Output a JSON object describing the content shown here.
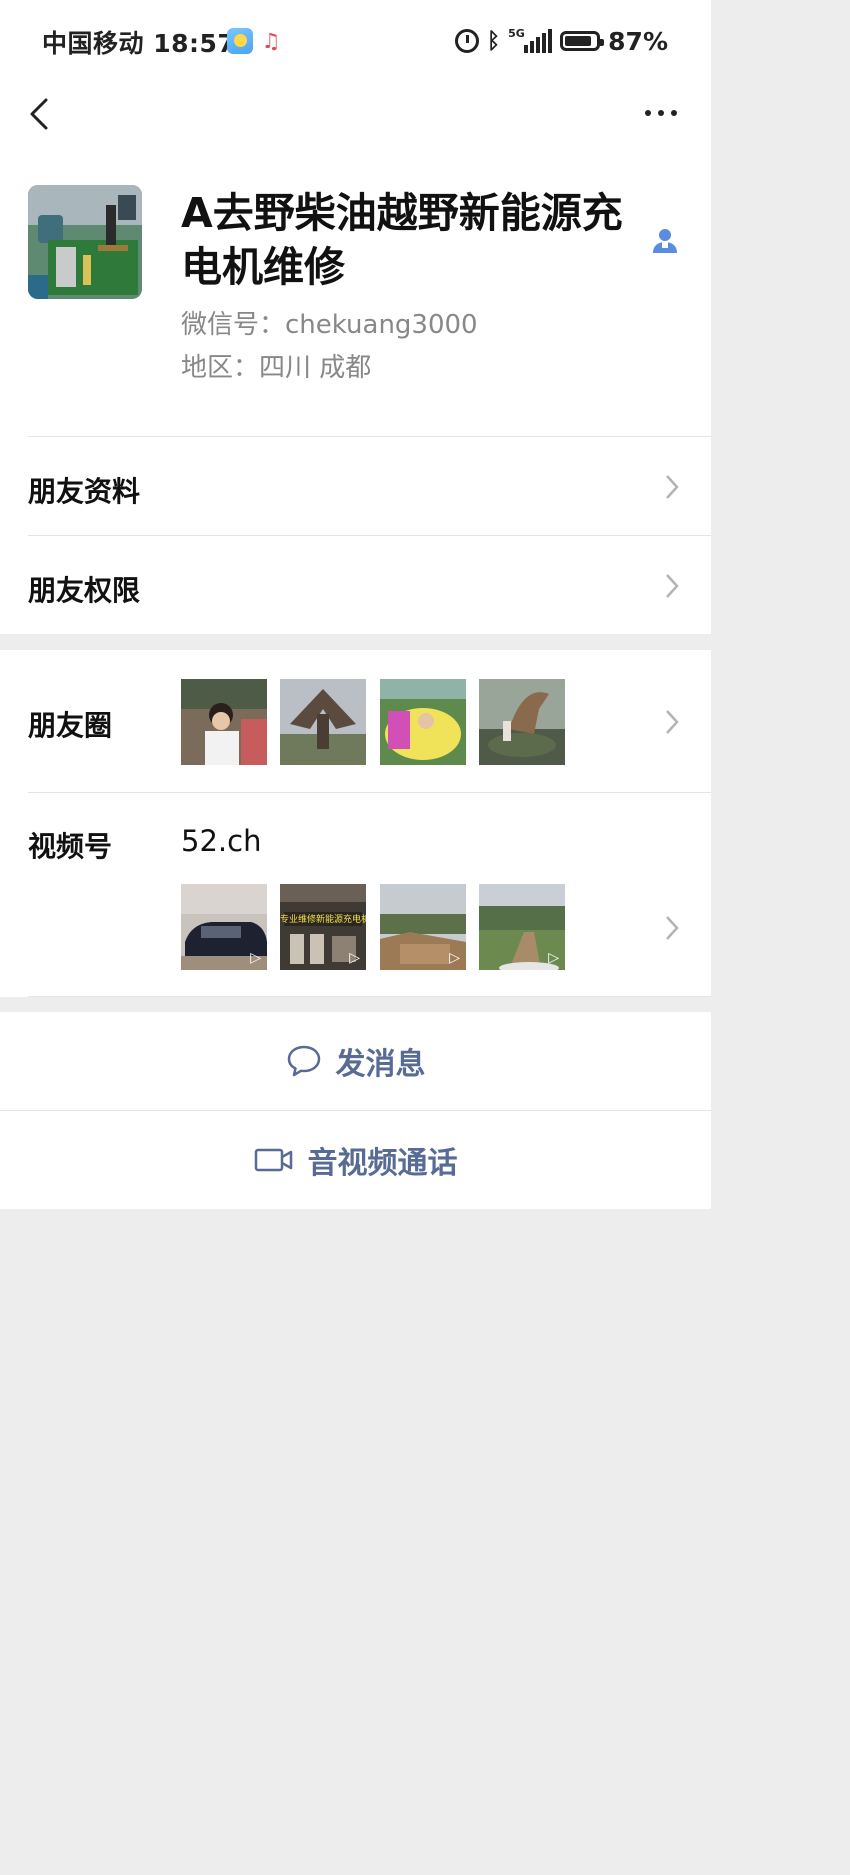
{
  "status_bar": {
    "carrier_time": "中国移动 18:57",
    "network": "5G",
    "battery_percent": 87,
    "battery_text": "87%"
  },
  "profile": {
    "name": "A去野柴油越野新能源充电机维修",
    "wechat_id_line": "微信号：chekuang3000",
    "region_line": "地区：四川  成都"
  },
  "rows": {
    "friend_info": "朋友资料",
    "friend_permissions": "朋友权限",
    "moments": "朋友圈",
    "channels": "视频号",
    "channels_name": "52.ch"
  },
  "video_thumb_text": "专业维修新能源充电机",
  "actions": {
    "send_message": "发消息",
    "av_call": "音视频通话"
  },
  "colors": {
    "link_blue": "#576b95",
    "page_bg": "#ededed",
    "accent_icon": "#5a8de0"
  },
  "icons": [
    "back-icon",
    "more-icon",
    "person-icon",
    "chevron-right-icon",
    "chat-bubble-icon",
    "video-camera-icon"
  ]
}
